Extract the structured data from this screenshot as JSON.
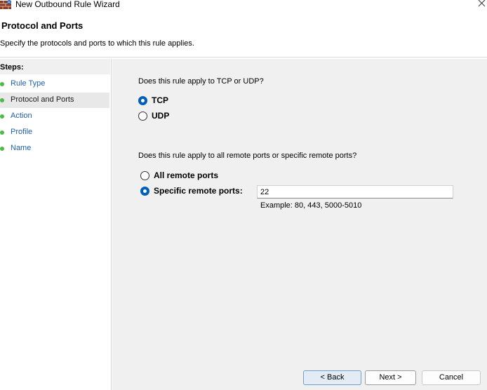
{
  "window": {
    "title": "New Outbound Rule Wizard",
    "close_glyph": "✕"
  },
  "header": {
    "title": "Protocol and Ports",
    "subtitle": "Specify the protocols and ports to which this rule applies."
  },
  "steps": {
    "header": "Steps:",
    "items": [
      {
        "label": "Rule Type",
        "current": false
      },
      {
        "label": "Protocol and Ports",
        "current": true
      },
      {
        "label": "Action",
        "current": false
      },
      {
        "label": "Profile",
        "current": false
      },
      {
        "label": "Name",
        "current": false
      }
    ]
  },
  "protocol": {
    "question": "Does this rule apply to TCP or UDP?",
    "options": [
      {
        "label": "TCP",
        "checked": true
      },
      {
        "label": "UDP",
        "checked": false
      }
    ]
  },
  "ports": {
    "question": "Does this rule apply to all remote ports or specific remote ports?",
    "options": [
      {
        "label": "All remote ports",
        "checked": false
      },
      {
        "label": "Specific remote ports:",
        "checked": true
      }
    ],
    "value": "22",
    "example": "Example: 80, 443, 5000-5010"
  },
  "buttons": {
    "back": "< Back",
    "next": "Next >",
    "cancel": "Cancel"
  },
  "colors": {
    "accent": "#005fb8",
    "step_dot": "#4fb94a",
    "step_link": "#1f5fa8",
    "panel_bg": "#f0f0f0"
  },
  "icons": {
    "app": "firewall-icon",
    "close": "close-icon"
  }
}
